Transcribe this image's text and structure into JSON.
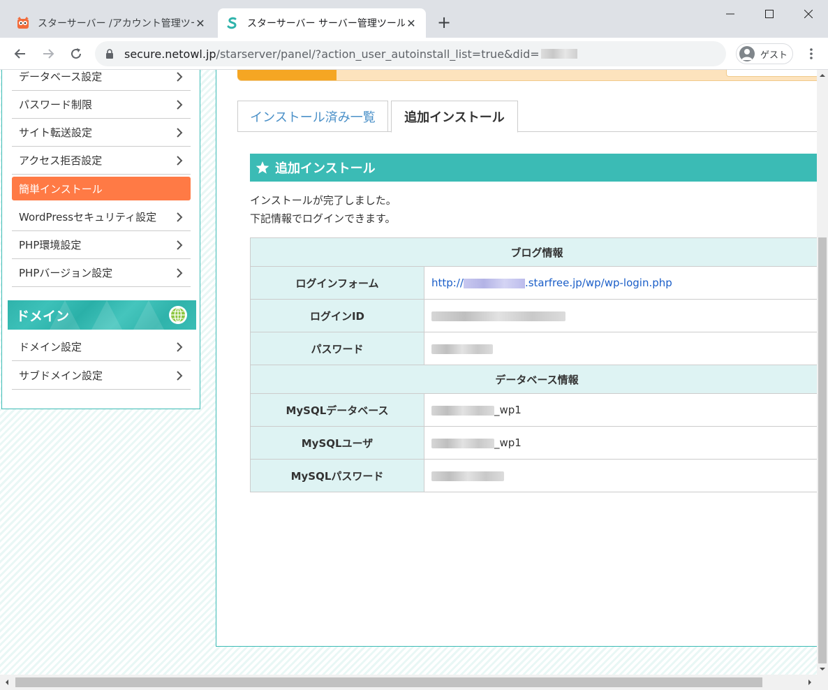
{
  "browser": {
    "tabs": [
      {
        "title": "スターサーバー /アカウント管理ツール",
        "favicon": "owl-icon",
        "active": false
      },
      {
        "title": "スターサーバー サーバー管理ツール",
        "favicon": "starserver-s-icon",
        "active": true
      }
    ],
    "address": {
      "url_host": "secure.netowl.jp",
      "url_rest": "/starserver/panel/?action_user_autoinstall_list=true&did="
    },
    "profile_label": "ゲスト"
  },
  "sidebar": {
    "items": [
      {
        "label": "データベース設定"
      },
      {
        "label": "パスワード制限"
      },
      {
        "label": "サイト転送設定"
      },
      {
        "label": "アクセス拒否設定"
      },
      {
        "label": "簡単インストール",
        "active": true
      },
      {
        "label": "WordPressセキュリティ設定"
      },
      {
        "label": "PHP環境設定"
      },
      {
        "label": "PHPバージョン設定"
      }
    ],
    "domain_section": {
      "title": "ドメイン",
      "items": [
        {
          "label": "ドメイン設定"
        },
        {
          "label": "サブドメイン設定"
        }
      ]
    }
  },
  "main": {
    "tabs": [
      {
        "label": "インストール済み一覧",
        "active": false
      },
      {
        "label": "追加インストール",
        "active": true
      }
    ],
    "section_title": "追加インストール",
    "message_line1": "インストールが完了しました。",
    "message_line2": "下記情報でログインできます。",
    "blog_info": {
      "header": "ブログ情報",
      "login_form_label": "ログインフォーム",
      "login_form_prefix": "http://",
      "login_form_suffix": ".starfree.jp/wp/wp-login.php",
      "login_id_label": "ログインID",
      "password_label": "パスワード"
    },
    "db_info": {
      "header": "データベース情報",
      "db_label": "MySQLデータベース",
      "db_suffix": "_wp1",
      "user_label": "MySQLユーザ",
      "user_suffix": "_wp1",
      "password_label": "MySQLパスワード"
    }
  },
  "colors": {
    "accent_teal": "#3bbbb5",
    "active_orange": "#ff7a45",
    "progress_orange": "#f5a623",
    "table_header_bg": "#def3f3",
    "link_blue": "#1a5ec8"
  }
}
